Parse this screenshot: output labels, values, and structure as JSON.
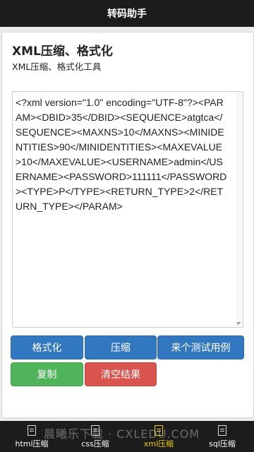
{
  "app": {
    "title": "转码助手"
  },
  "header": {
    "title": "XML压缩、格式化",
    "subtitle": "XML压缩、格式化工具"
  },
  "editor": {
    "content": "<?xml version=\"1.0\" encoding=\"UTF-8\"?><PARAM><DBID>35</DBID><SEQUENCE>atgtca</SEQUENCE><MAXNS>10</MAXNS><MINIDENTITIES>90</MINIDENTITIES><MAXEVALUE>10</MAXEVALUE><USERNAME>admin</USERNAME><PASSWORD>111111</PASSWORD><TYPE>P</TYPE><RETURN_TYPE>2</RETURN_TYPE></PARAM>"
  },
  "buttons": {
    "format": "格式化",
    "compress": "压缩",
    "sample": "来个测试用例",
    "copy": "复制",
    "clear": "清空结果"
  },
  "tabs": [
    {
      "label": "html压缩",
      "icon": "document-icon"
    },
    {
      "label": "css压缩",
      "icon": "document-icon"
    },
    {
      "label": "xml压缩",
      "icon": "document-icon",
      "active": true
    },
    {
      "label": "sql压缩",
      "icon": "document-icon"
    }
  ],
  "watermark": "晨曦乐下载 · CXLEDU.COM",
  "colors": {
    "primary_button": "#3178c0",
    "copy_button": "#4fb45a",
    "clear_button": "#d9534f",
    "active_tab": "#f0d000",
    "bar_background": "#1c1c1c"
  }
}
